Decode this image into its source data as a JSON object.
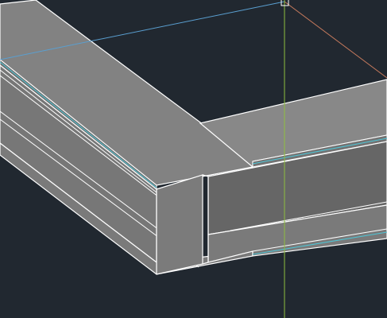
{
  "viewport": {
    "background": "#212830",
    "visual_style": "shaded-with-edges"
  },
  "model": {
    "beams": [
      {
        "name": "diagonal-i-beam",
        "profile": "i-beam",
        "direction": "upper-left"
      },
      {
        "name": "horizontal-i-beam",
        "profile": "i-beam",
        "direction": "right"
      }
    ],
    "surface_colors": {
      "top_face": "#828282",
      "side_face": "#777777",
      "web_face": "#666666",
      "inner_face": "#707070"
    },
    "edge_color": "#ffffff",
    "edge_highlight_color": "#4ec5d5"
  },
  "crosshair": {
    "x_axis_color": "#5a9fd0",
    "y_axis_color": "#8fbf3e",
    "z_axis_color": "#c4795c",
    "cursor_icon": "pickbox-icon"
  }
}
